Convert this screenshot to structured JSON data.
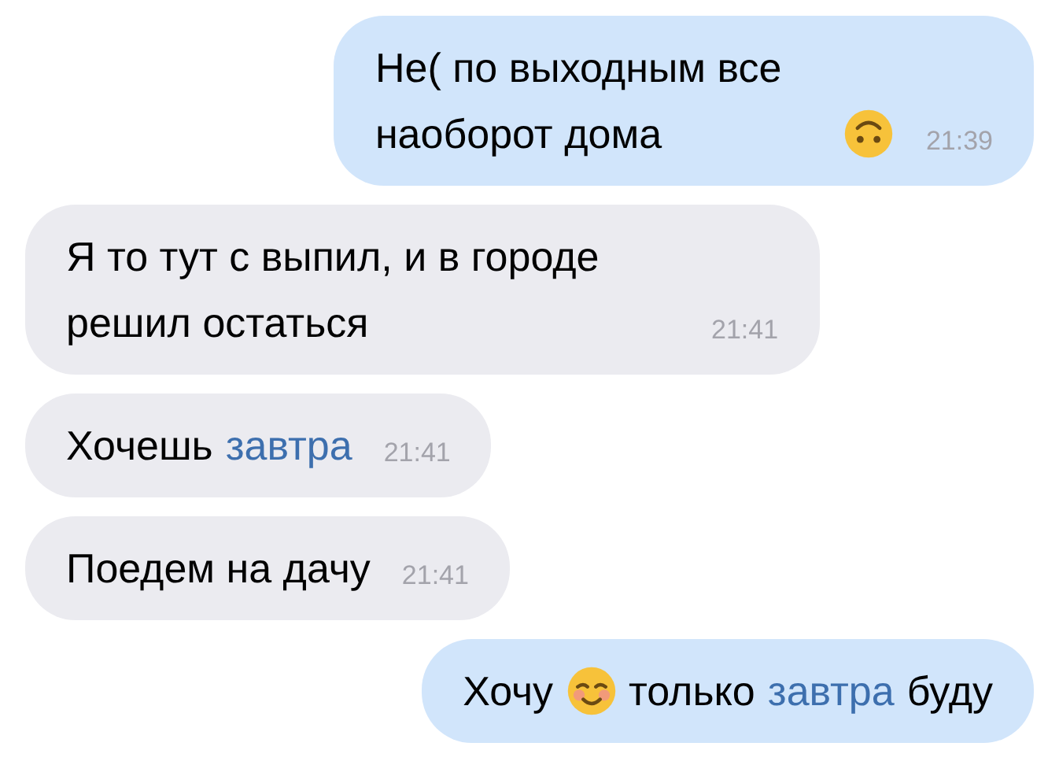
{
  "messages": [
    {
      "outgoing": true,
      "segments": [
        {
          "kind": "text",
          "text": "Не( по выходным все наоборот дома "
        },
        {
          "kind": "upsideface"
        }
      ],
      "time": "21:39"
    },
    {
      "outgoing": false,
      "segments": [
        {
          "kind": "text",
          "text": "Я то тут с выпил, и в городе решил остаться"
        }
      ],
      "time": "21:41"
    },
    {
      "outgoing": false,
      "segments": [
        {
          "kind": "text",
          "text": "Хочешь "
        },
        {
          "kind": "link",
          "text": "завтра"
        }
      ],
      "time": "21:41"
    },
    {
      "outgoing": false,
      "segments": [
        {
          "kind": "text",
          "text": "Поедем на дачу"
        }
      ],
      "time": "21:41"
    },
    {
      "outgoing": true,
      "segments": [
        {
          "kind": "text",
          "text": "Хочу "
        },
        {
          "kind": "blushface"
        },
        {
          "kind": "text",
          "text": "только "
        },
        {
          "kind": "link",
          "text": "завтра"
        },
        {
          "kind": "text",
          "text": " буду"
        }
      ]
    }
  ]
}
